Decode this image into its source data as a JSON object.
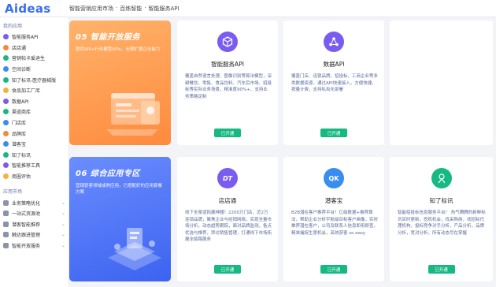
{
  "header": {
    "logo": "Aideas",
    "breadcrumb": [
      "智能营销应用市场",
      "·",
      "百炼智能",
      "·",
      "智能服务API"
    ]
  },
  "sidebar": {
    "section1": "我的应用",
    "items1": [
      {
        "label": "智能服务API",
        "color": "#7a5cf0"
      },
      {
        "label": "店店通",
        "color": "#f08a3a"
      },
      {
        "label": "营销帖卡爱迪生",
        "color": "#16b982"
      },
      {
        "label": "空间诊断",
        "color": "#3a8df0"
      },
      {
        "label": "知了标讯-医疗器械版",
        "color": "#16b982"
      },
      {
        "label": "食品加工厂库",
        "color": "#f0b43a"
      },
      {
        "label": "数据API",
        "color": "#7a5cf0"
      },
      {
        "label": "渠道商库",
        "color": "#16b982"
      },
      {
        "label": "门店库",
        "color": "#3a8df0"
      },
      {
        "label": "品牌库",
        "color": "#f08a3a"
      },
      {
        "label": "潜客宝",
        "color": "#3a8df0"
      },
      {
        "label": "知了标讯",
        "color": "#16b982"
      },
      {
        "label": "智能推荐工具",
        "color": "#7a5cf0"
      },
      {
        "label": "商圈评估",
        "color": "#f0b43a"
      }
    ],
    "section2": "应用市场",
    "items2": [
      {
        "label": "业务策略优化",
        "color": "#8a93a8"
      },
      {
        "label": "一站式资源池",
        "color": "#8a93a8"
      },
      {
        "label": "潜客智能推荐",
        "color": "#8a93a8"
      },
      {
        "label": "触达跟进管理",
        "color": "#8a93a8"
      },
      {
        "label": "智能开放服务",
        "color": "#8a93a8"
      }
    ]
  },
  "promos": {
    "orange": {
      "title": "05 智能开放服务",
      "desc": "提供API+行业模型APIs，无限扩展企业能力"
    },
    "blue": {
      "title": "06 综合应用专区",
      "desc": "营销获客领域成熟应用，已搭配好的应用套餐方案"
    }
  },
  "cards": [
    {
      "name": "智能服务API",
      "desc": "覆盖自然语言处理、图像识别等算法模型，深耕餐饮、零售、食品饮料、汽车后市场、招投标等实际业务场景，精准度90%+、支持业务策略定制",
      "button": "已开通",
      "icon": "cube-icon",
      "color": "#7a5cf0"
    },
    {
      "name": "数据API",
      "desc": "覆盖门店、连锁品牌、招投标、工商企业等多类数据资源，通过API快速接入，方便快捷，按量计费，支持私有化部署",
      "button": "已开通",
      "icon": "network-icon",
      "color": "#7a5cf0"
    },
    {
      "name": "店店通",
      "desc": "线下全渠道拓展神器！2200万门店，近2万连锁品牌，聚焦企业与经销网络，实现全量市场分析，动态趋势跟踪，面对品牌监测，售点优选与推荐，拜访销售管理，打通线下市场拓展全链路服务",
      "button": "已开通",
      "icon": "dt-icon",
      "color": "#7a5cf0"
    },
    {
      "name": "潜客宝",
      "desc": "B2B潜在客户推荐平台！亿级数据+推荐算法，帮助企业分析宇航级目标客户画像，实时推荐潜在客户，公司及联系人信息即用即查，精准捕捉生意机会，高效获客 so easy",
      "button": "已开通",
      "icon": "qk-icon",
      "color": "#3a8df0"
    },
    {
      "name": "知了标讯",
      "desc": "智能招投标信息服务平台！ 热气腾腾的新鲜标讯实时更新，挖机机会，找采购商，找招标代理机构，投标竞争对手分析，产品分析，品牌分析，竞对分析，所有动态尽在掌握",
      "button": "已开通",
      "icon": "zl-icon",
      "color": "#16b982"
    }
  ]
}
